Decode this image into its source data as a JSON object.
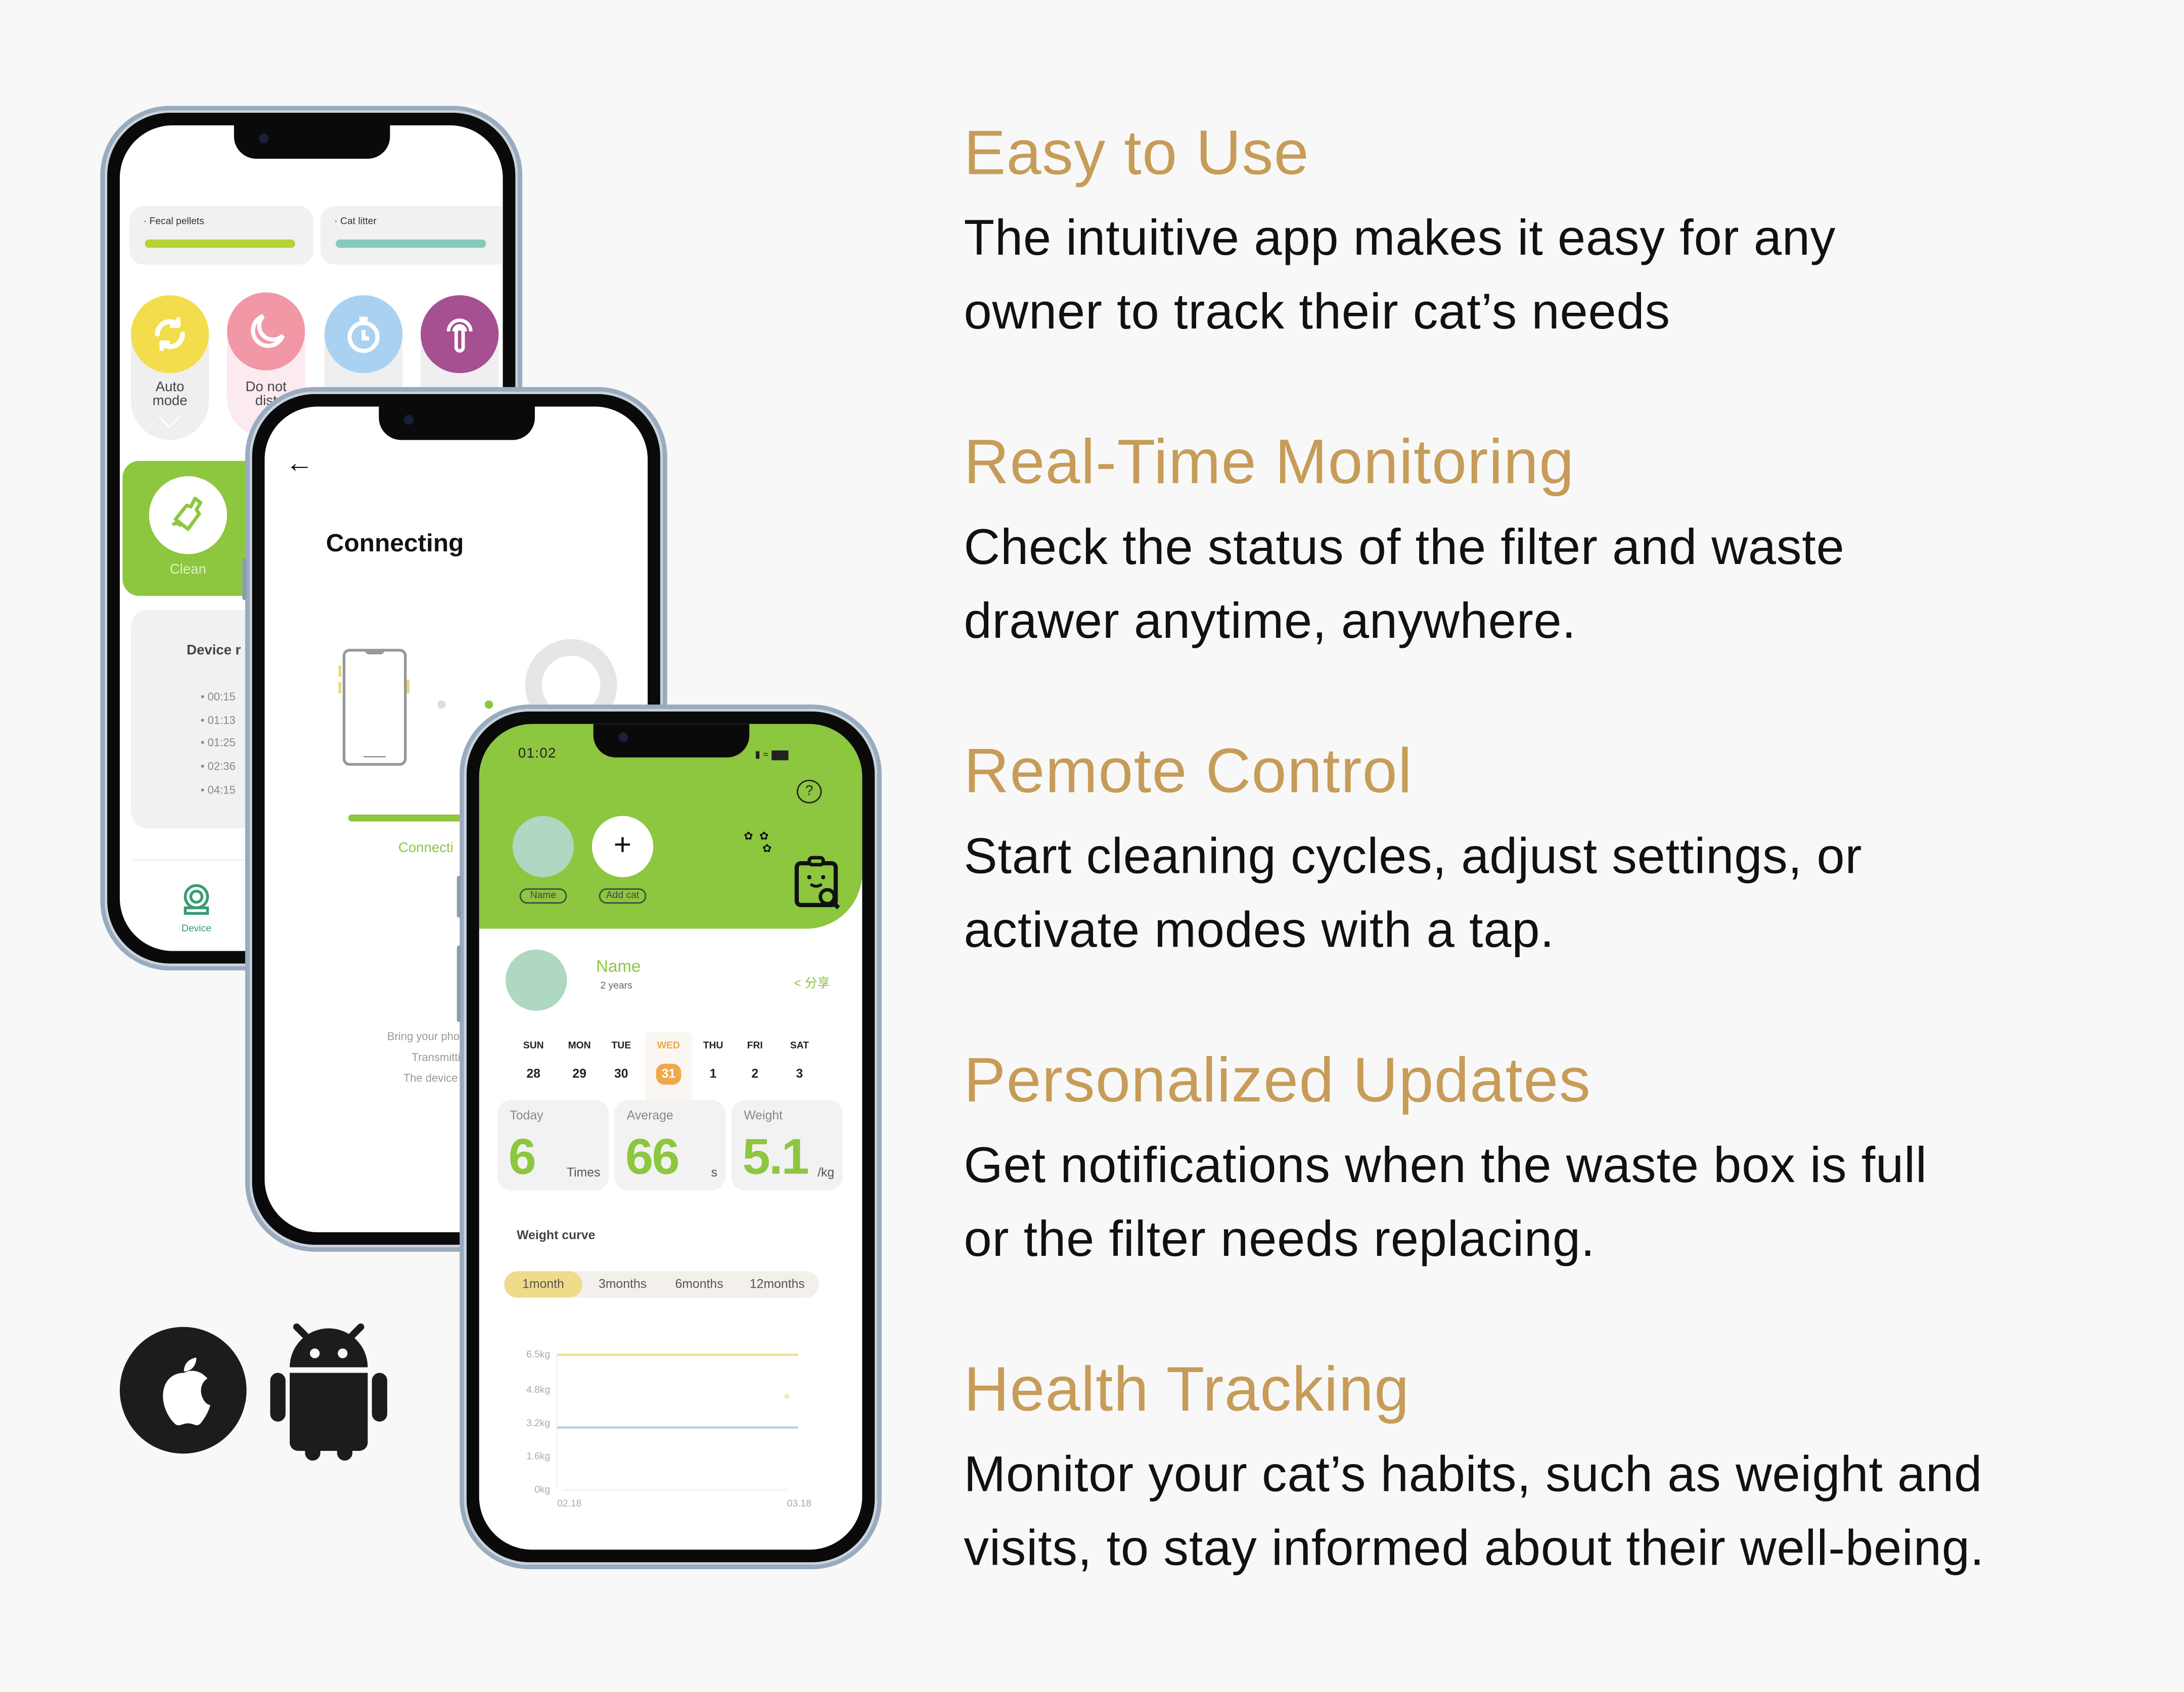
{
  "colors": {
    "background": "#f8f8f8",
    "heading": "#c79c58",
    "body_text": "#111111",
    "app_green": "#8dc63f",
    "mint": "#aed8c1",
    "orange": "#eea84b"
  },
  "features": [
    {
      "title": "Easy to Use",
      "lines": [
        "The intuitive app makes it easy for any",
        "owner to track their cat’s needs"
      ]
    },
    {
      "title": "Real-Time Monitoring",
      "lines": [
        "Check the status of the filter and waste",
        "drawer anytime, anywhere."
      ]
    },
    {
      "title": "Remote Control",
      "lines": [
        "Start cleaning cycles, adjust settings, or",
        "activate modes with a tap."
      ]
    },
    {
      "title": "Personalized Updates",
      "lines": [
        "Get notifications when the waste box is full",
        "or the filter needs replacing."
      ]
    },
    {
      "title": "Health Tracking",
      "lines": [
        "Monitor your cat’s habits, such as weight and",
        "visits, to stay informed about their well-being."
      ]
    }
  ],
  "platform_icons": [
    "apple-icon",
    "android-icon"
  ],
  "device_screen": {
    "levels": [
      {
        "label": "Fecal pellets",
        "color": "#b5d334",
        "fill_percent": 100
      },
      {
        "label": "Cat litter",
        "color": "#86cbb9",
        "fill_percent": 100
      }
    ],
    "modes": [
      {
        "label_line1": "Auto",
        "label_line2": "mode",
        "icon": "refresh-icon",
        "color": "#f3dd4d"
      },
      {
        "label_line1": "Do not",
        "label_line2": "dist",
        "icon": "moon-icon",
        "color": "#f197a5"
      },
      {
        "icon": "stopwatch-icon",
        "color": "#a9d1f1"
      },
      {
        "icon": "tap-icon",
        "color": "#a64f91"
      }
    ],
    "clean_label": "Clean",
    "records_title": "Device r",
    "records": [
      "00:15",
      "01:13",
      "01:25",
      "02:36",
      "04:15"
    ],
    "nav_device": "Device"
  },
  "connecting_screen": {
    "title": "Connecting",
    "status": "Connecti",
    "hints": [
      "Bring your phone an",
      "Transmitting inf",
      "The device is cor"
    ]
  },
  "cat_screen": {
    "time": "01:02",
    "cats": [
      {
        "label": "Name"
      },
      {
        "label": "Add cat"
      }
    ],
    "profile": {
      "name": "Name",
      "age": "2 years",
      "share": "分享"
    },
    "week": [
      {
        "day": "SUN",
        "date": "28"
      },
      {
        "day": "MON",
        "date": "29"
      },
      {
        "day": "TUE",
        "date": "30"
      },
      {
        "day": "WED",
        "date": "31",
        "selected": true
      },
      {
        "day": "THU",
        "date": "1"
      },
      {
        "day": "FRI",
        "date": "2"
      },
      {
        "day": "SAT",
        "date": "3"
      }
    ],
    "stats": [
      {
        "label": "Today",
        "value": "6",
        "unit": "Times"
      },
      {
        "label": "Average",
        "value": "66",
        "unit": "s"
      },
      {
        "label": "Weight",
        "value": "5.1",
        "unit": "/kg"
      }
    ],
    "weight_title": "Weight curve",
    "tabs": [
      {
        "label": "1month",
        "active": true
      },
      {
        "label": "3months"
      },
      {
        "label": "6months"
      },
      {
        "label": "12months"
      }
    ]
  },
  "chart_data": {
    "type": "line",
    "title": "Weight curve",
    "x_ticks": [
      "02.18",
      "03.18"
    ],
    "y_ticks": [
      "6.5kg",
      "4.8kg",
      "3.2kg",
      "1.6kg",
      "0kg"
    ],
    "ylim": [
      0,
      6.5
    ],
    "series": [
      {
        "color": "#eedc8a",
        "values": [
          6.5,
          6.5
        ]
      },
      {
        "color": "#b9cbe6",
        "values": [
          3.0,
          3.0
        ]
      }
    ],
    "points": [
      {
        "x": "03.18",
        "y": 4.5,
        "color": "#e4f0b0"
      }
    ]
  }
}
